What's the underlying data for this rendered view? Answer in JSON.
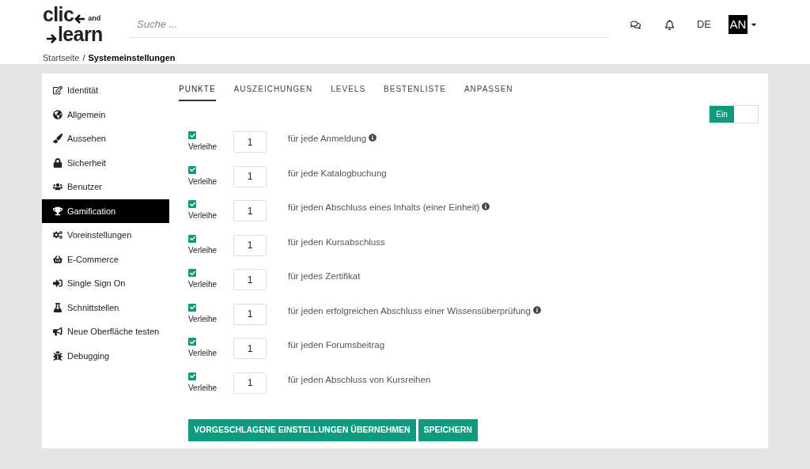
{
  "header": {
    "logo": {
      "top": "clic",
      "small": "and",
      "bottom": "learn"
    },
    "search": {
      "placeholder": "Suche ..."
    },
    "language": "DE",
    "avatar": "AN"
  },
  "breadcrumb_separator": "/",
  "breadcrumb": [
    {
      "label": "Startseite",
      "current": false
    },
    {
      "label": "Systemeinstellungen",
      "current": true
    }
  ],
  "sidebar": {
    "items": [
      {
        "label": "Identität",
        "selected": false
      },
      {
        "label": "Allgemein",
        "selected": false
      },
      {
        "label": "Aussehen",
        "selected": false
      },
      {
        "label": "Sicherheit",
        "selected": false
      },
      {
        "label": "Benutzer",
        "selected": false
      },
      {
        "label": "Gamification",
        "selected": true
      },
      {
        "label": "Voreinstellungen",
        "selected": false
      },
      {
        "label": "E-Commerce",
        "selected": false
      },
      {
        "label": "Single Sign On",
        "selected": false
      },
      {
        "label": "Schnittstellen",
        "selected": false
      },
      {
        "label": "Neue Oberfläche testen",
        "selected": false
      },
      {
        "label": "Debugging",
        "selected": false
      }
    ]
  },
  "tabs": [
    {
      "label": "PUNKTE",
      "selected": true
    },
    {
      "label": "AUSZEICHUNGEN",
      "selected": false
    },
    {
      "label": "LEVELS",
      "selected": false
    },
    {
      "label": "BESTENLISTE",
      "selected": false
    },
    {
      "label": "ANPASSEN",
      "selected": false
    }
  ],
  "toggle": {
    "label": "Ein",
    "on": true
  },
  "rows": [
    {
      "checked": true,
      "check_label": "Verleihe",
      "value": "1",
      "text": "für jede Anmeldung",
      "info": true
    },
    {
      "checked": true,
      "check_label": "Verleihe",
      "value": "1",
      "text": "für jede Katalogbuchung",
      "info": false
    },
    {
      "checked": true,
      "check_label": "Verleihe",
      "value": "1",
      "text": "für jeden Abschluss eines Inhalts (einer Einheit)",
      "info": true
    },
    {
      "checked": true,
      "check_label": "Verleihe",
      "value": "1",
      "text": "für jeden Kursabschluss",
      "info": false
    },
    {
      "checked": true,
      "check_label": "Verleihe",
      "value": "1",
      "text": "für jedes Zertifikat",
      "info": false
    },
    {
      "checked": true,
      "check_label": "Verleihe",
      "value": "1",
      "text": "für jeden erfolgreichen Abschluss einer Wissensüberprüfung",
      "info": true
    },
    {
      "checked": true,
      "check_label": "Verleihe",
      "value": "1",
      "text": "für jeden Forumsbeitrag",
      "info": false
    },
    {
      "checked": true,
      "check_label": "Verleihe",
      "value": "1",
      "text": "für jeden Abschluss von Kursreihen",
      "info": false
    }
  ],
  "buttons": [
    "VORGESCHLAGENE EINSTELLUNGEN ÜBERNEHMEN",
    "SPEICHERN"
  ]
}
